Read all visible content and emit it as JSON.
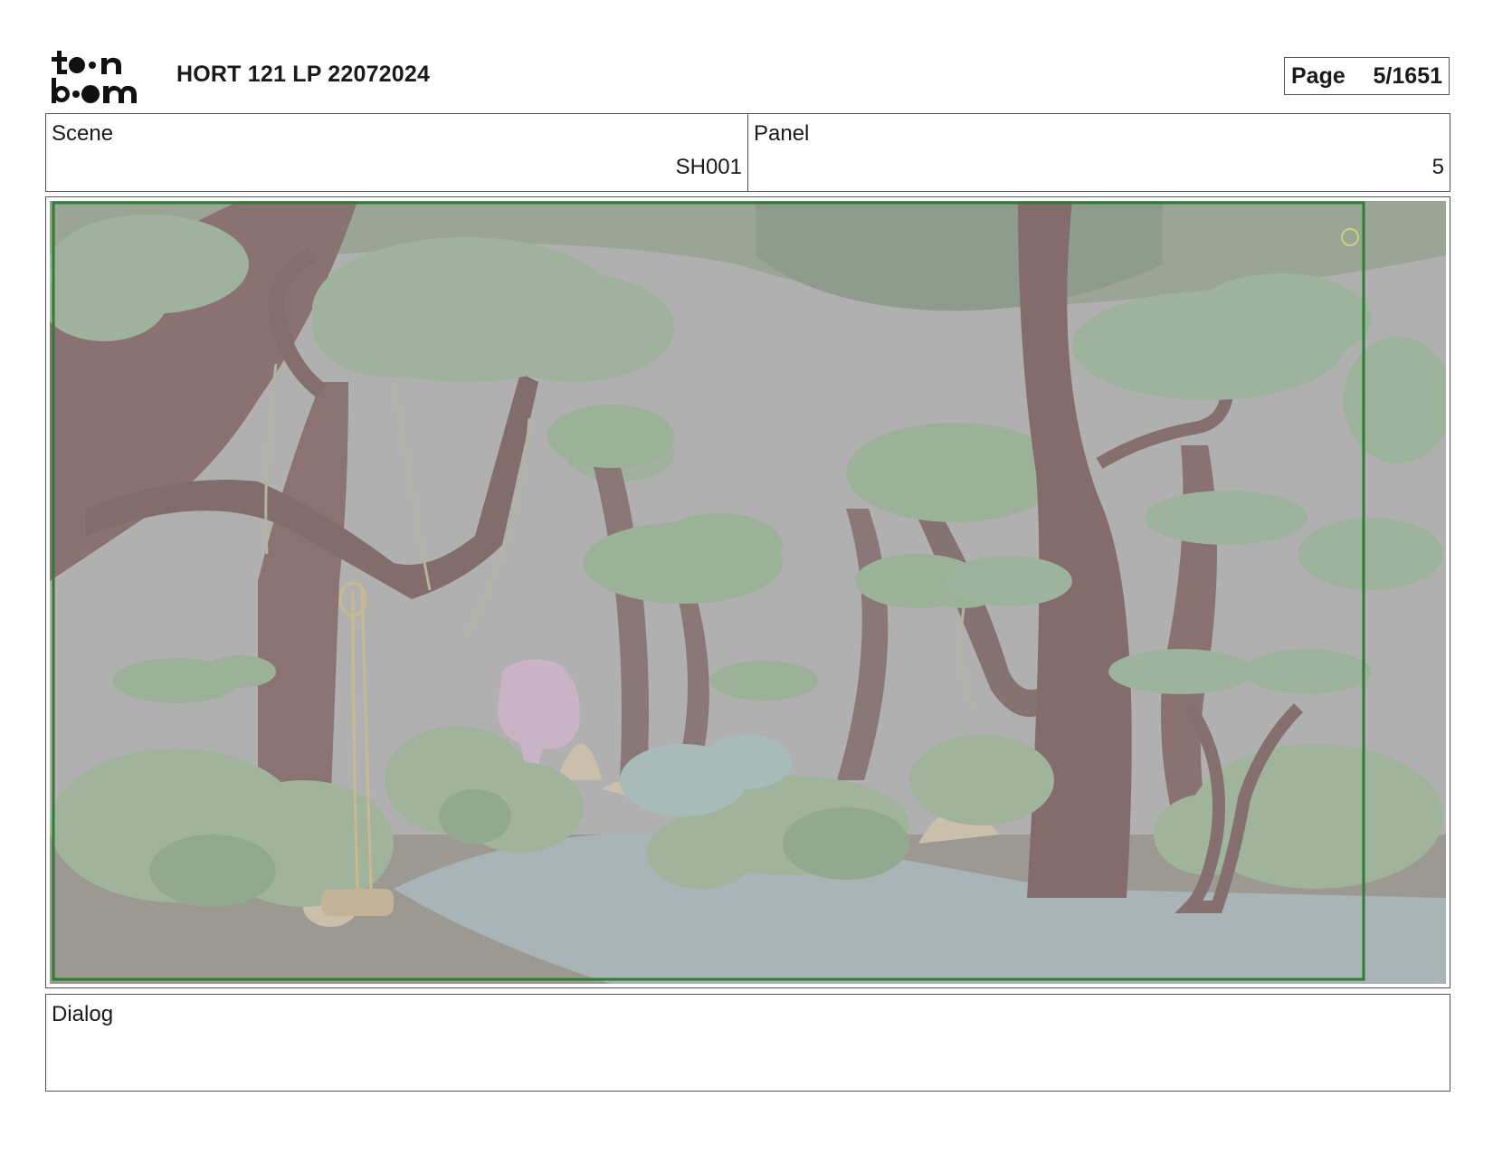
{
  "header": {
    "logo_icon": "toonboom-logo-icon",
    "project_title": "HORT 121 LP 22072024",
    "page_label": "Page",
    "page_value": "5/1651"
  },
  "info": {
    "scene_label": "Scene",
    "scene_value": "SH001",
    "panel_label": "Panel",
    "panel_value": "5"
  },
  "panel": {
    "image_icon": "storyboard-forest-scene-image",
    "frame_color": "#2e7d32"
  },
  "dialog": {
    "label": "Dialog"
  }
}
